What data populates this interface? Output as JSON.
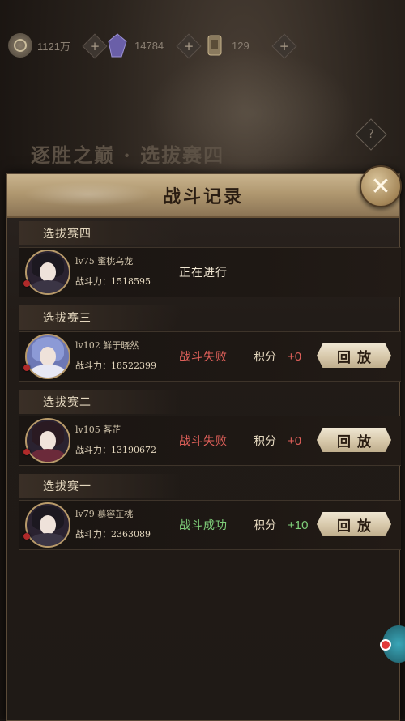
{
  "resources": [
    {
      "icon": "coin-icon",
      "value": "1121万"
    },
    {
      "icon": "crystal-icon",
      "value": "14784"
    },
    {
      "icon": "scroll-icon",
      "value": "129"
    }
  ],
  "background_title": "逐胜之巅 · 选拔赛四",
  "help_label": "?",
  "panel": {
    "title": "战斗记录",
    "close_label": "✕"
  },
  "score_label": "积分",
  "replay_label": "回放",
  "records": [
    {
      "round": "选拔赛四",
      "level_name": "lv75 蜜桃乌龙",
      "power": "战斗力：1518595",
      "result": "正在进行",
      "result_type": "ongoing",
      "score": "",
      "show_replay": false
    },
    {
      "round": "选拔赛三",
      "level_name": "lv102 鲜于晓然",
      "power": "战斗力：18522399",
      "result": "战斗失败",
      "result_type": "lose",
      "score": "+0",
      "show_replay": true
    },
    {
      "round": "选拔赛二",
      "level_name": "lv105 茖芷",
      "power": "战斗力：13190672",
      "result": "战斗失败",
      "result_type": "lose",
      "score": "+0",
      "show_replay": true
    },
    {
      "round": "选拔赛一",
      "level_name": "lv79 慕容芷桃",
      "power": "战斗力：2363089",
      "result": "战斗成功",
      "result_type": "win",
      "score": "+10",
      "show_replay": true
    }
  ]
}
